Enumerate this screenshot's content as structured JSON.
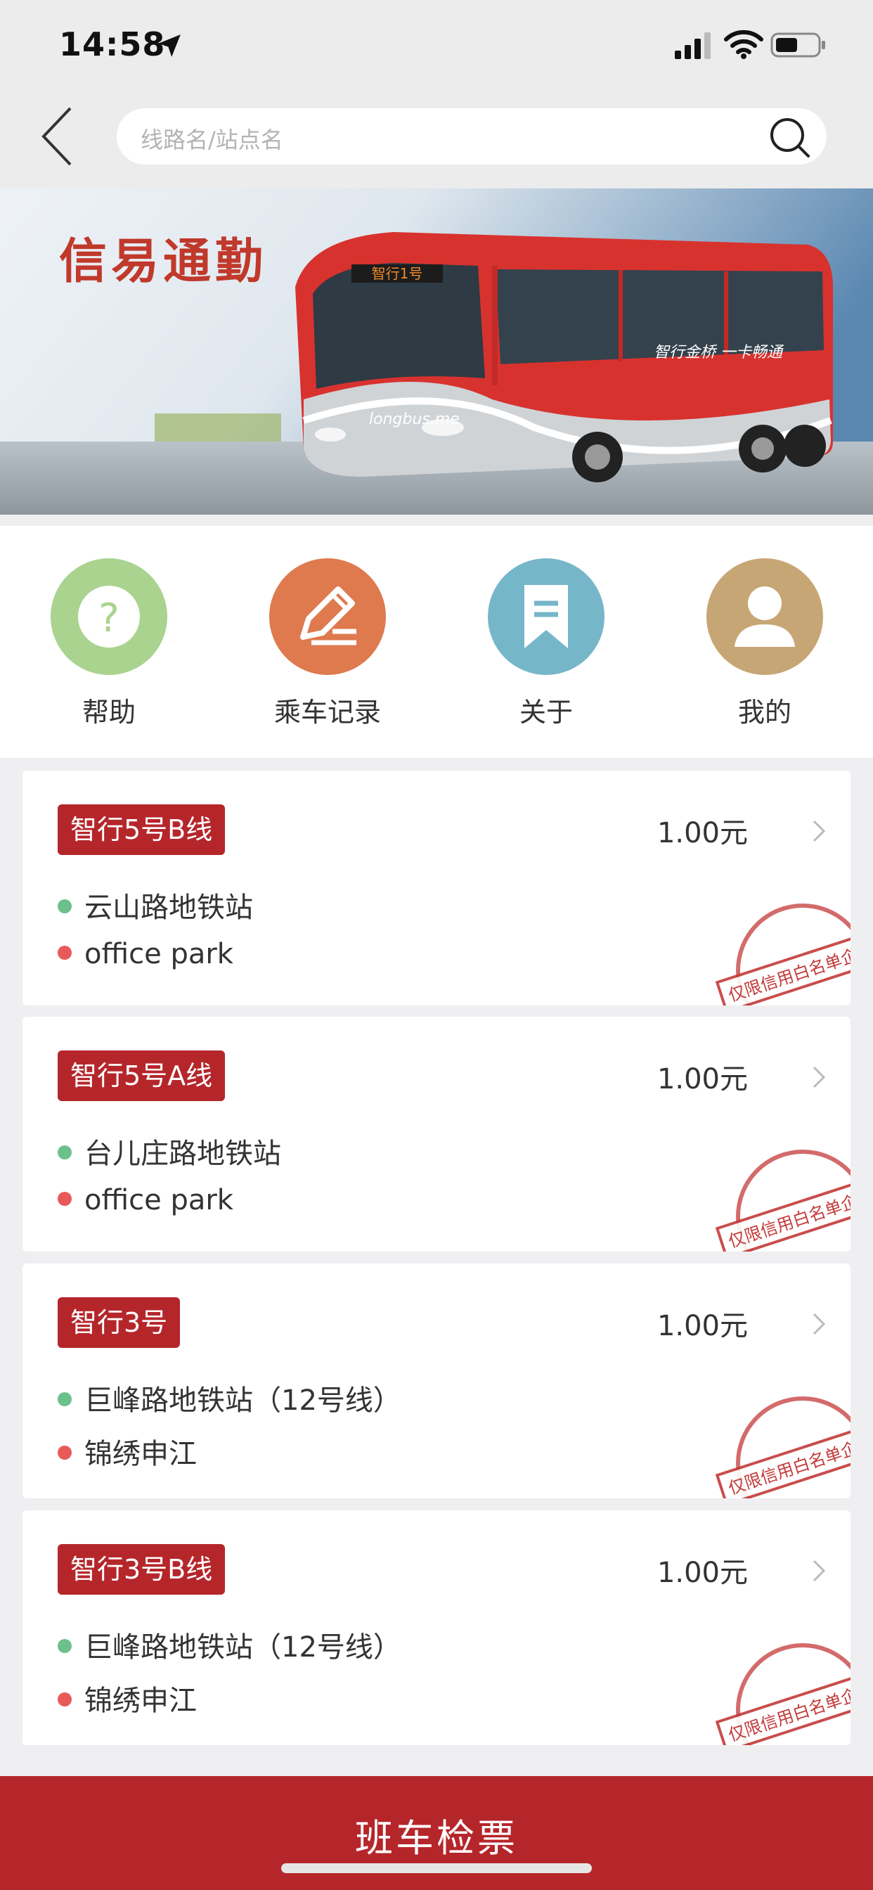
{
  "status_bar": {
    "time": "14:58"
  },
  "search": {
    "placeholder": "线路名/站点名"
  },
  "banner": {
    "title": "信易通勤",
    "bus_destination": "智行1号",
    "bus_brand": "longbus.me",
    "bus_side_text": "智行金桥 一卡畅通"
  },
  "quick_actions": [
    {
      "label": "帮助",
      "icon": "question-mark-icon",
      "color": "#a9d38f"
    },
    {
      "label": "乘车记录",
      "icon": "edit-pen-icon",
      "color": "#de7a4e"
    },
    {
      "label": "关于",
      "icon": "bookmark-icon",
      "color": "#76b6c9"
    },
    {
      "label": "我的",
      "icon": "user-icon",
      "color": "#c7a675"
    }
  ],
  "routes": [
    {
      "name": "智行5号B线",
      "price": "1.00元",
      "start": "云山路地铁站",
      "end": "office park",
      "stamp_text": "仅限信用白名单企业"
    },
    {
      "name": "智行5号A线",
      "price": "1.00元",
      "start": "台儿庄路地铁站",
      "end": "office park",
      "stamp_text": "仅限信用白名单企业"
    },
    {
      "name": "智行3号",
      "price": "1.00元",
      "start": "巨峰路地铁站（12号线）",
      "end": "锦绣申江",
      "stamp_text": "仅限信用白名单企业"
    },
    {
      "name": "智行3号B线",
      "price": "1.00元",
      "start": "巨峰路地铁站（12号线）",
      "end": "锦绣申江",
      "stamp_text": "仅限信用白名单企业"
    }
  ],
  "bottom_button": {
    "label": "班车检票"
  },
  "colors": {
    "accent": "#b5262b",
    "start_dot": "#6cc08b",
    "end_dot": "#e85a5a"
  }
}
